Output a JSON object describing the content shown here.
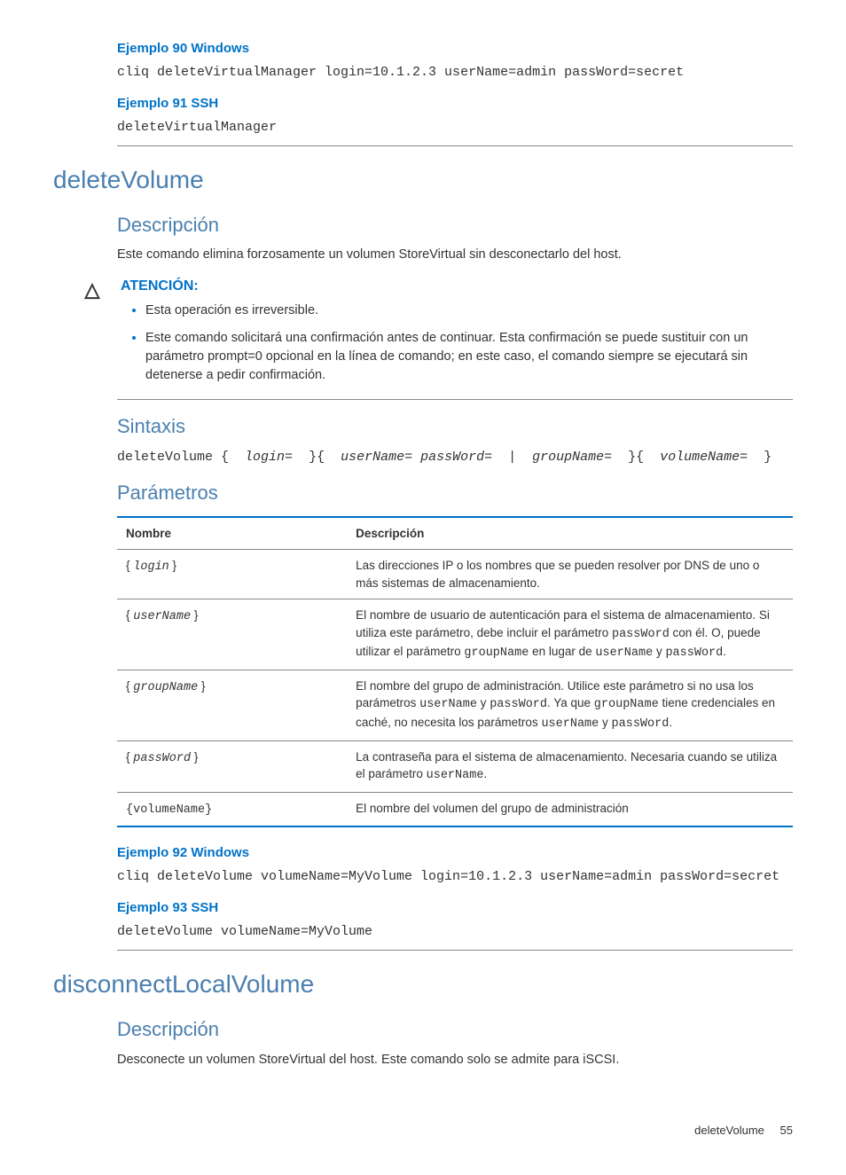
{
  "top": {
    "ex90_title": "Ejemplo 90 Windows",
    "ex90_code": "cliq deleteVirtualManager login=10.1.2.3 userName=admin passWord=secret",
    "ex91_title": "Ejemplo 91 SSH",
    "ex91_code": "deleteVirtualManager"
  },
  "deleteVolume": {
    "title": "deleteVolume",
    "desc_title": "Descripción",
    "desc_text": "Este comando elimina forzosamente un volumen StoreVirtual sin desconectarlo del host.",
    "caution_label": "ATENCIÓN:",
    "bullet1": "Esta operación es irreversible.",
    "bullet2": "Este comando solicitará una confirmación antes de continuar. Esta confirmación se puede sustituir con un parámetro prompt=0 opcional en la línea de comando; en este caso, el comando siempre se ejecutará sin detenerse a pedir confirmación.",
    "sintaxis_title": "Sintaxis",
    "sintaxis_cmd": "deleteVolume",
    "sintaxis_p1": "login=",
    "sintaxis_p2": "userName= passWord=",
    "sintaxis_p3": "groupName=",
    "sintaxis_p4": "volumeName=",
    "params_title": "Parámetros",
    "table": {
      "h_name": "Nombre",
      "h_desc": "Descripción",
      "rows": [
        {
          "name": "login",
          "desc_plain": "Las direcciones IP o los nombres que se pueden resolver por DNS de uno o más sistemas de almacenamiento."
        },
        {
          "name": "userName"
        },
        {
          "name": "groupName"
        },
        {
          "name": "passWord"
        },
        {
          "name_raw": "{volumeName}",
          "desc_plain": "El nombre del volumen del grupo de administración"
        }
      ],
      "r2": {
        "t1": "El nombre de usuario de autenticación para el sistema de almacenamiento. Si utiliza este parámetro, debe incluir el parámetro ",
        "c1": "passWord",
        "t2": " con él. O, puede utilizar el parámetro ",
        "c2": "groupName",
        "t3": " en lugar de ",
        "c3": "userName",
        "t4": " y ",
        "c4": "passWord",
        "t5": "."
      },
      "r3": {
        "t1": "El nombre del grupo de administración. Utilice este parámetro si no usa los parámetros ",
        "c1": "userName",
        "t2": " y ",
        "c2": "passWord",
        "t3": ". Ya que ",
        "c3": "groupName",
        "t4": " tiene credenciales en caché, no necesita los parámetros ",
        "c4": "userName",
        "t5": " y ",
        "c5": "passWord",
        "t6": "."
      },
      "r4": {
        "t1": "La contraseña para el sistema de almacenamiento. Necesaria cuando se utiliza el parámetro ",
        "c1": "userName",
        "t2": "."
      }
    },
    "ex92_title": "Ejemplo 92 Windows",
    "ex92_code": "cliq deleteVolume volumeName=MyVolume login=10.1.2.3 userName=admin passWord=secret",
    "ex93_title": "Ejemplo 93 SSH",
    "ex93_code": "deleteVolume volumeName=MyVolume"
  },
  "disconnect": {
    "title": "disconnectLocalVolume",
    "desc_title": "Descripción",
    "desc_text": "Desconecte un volumen StoreVirtual del host. Este comando solo se admite para iSCSI."
  },
  "footer": {
    "label": "deleteVolume",
    "page": "55"
  },
  "glyphs": {
    "caution": "△"
  }
}
